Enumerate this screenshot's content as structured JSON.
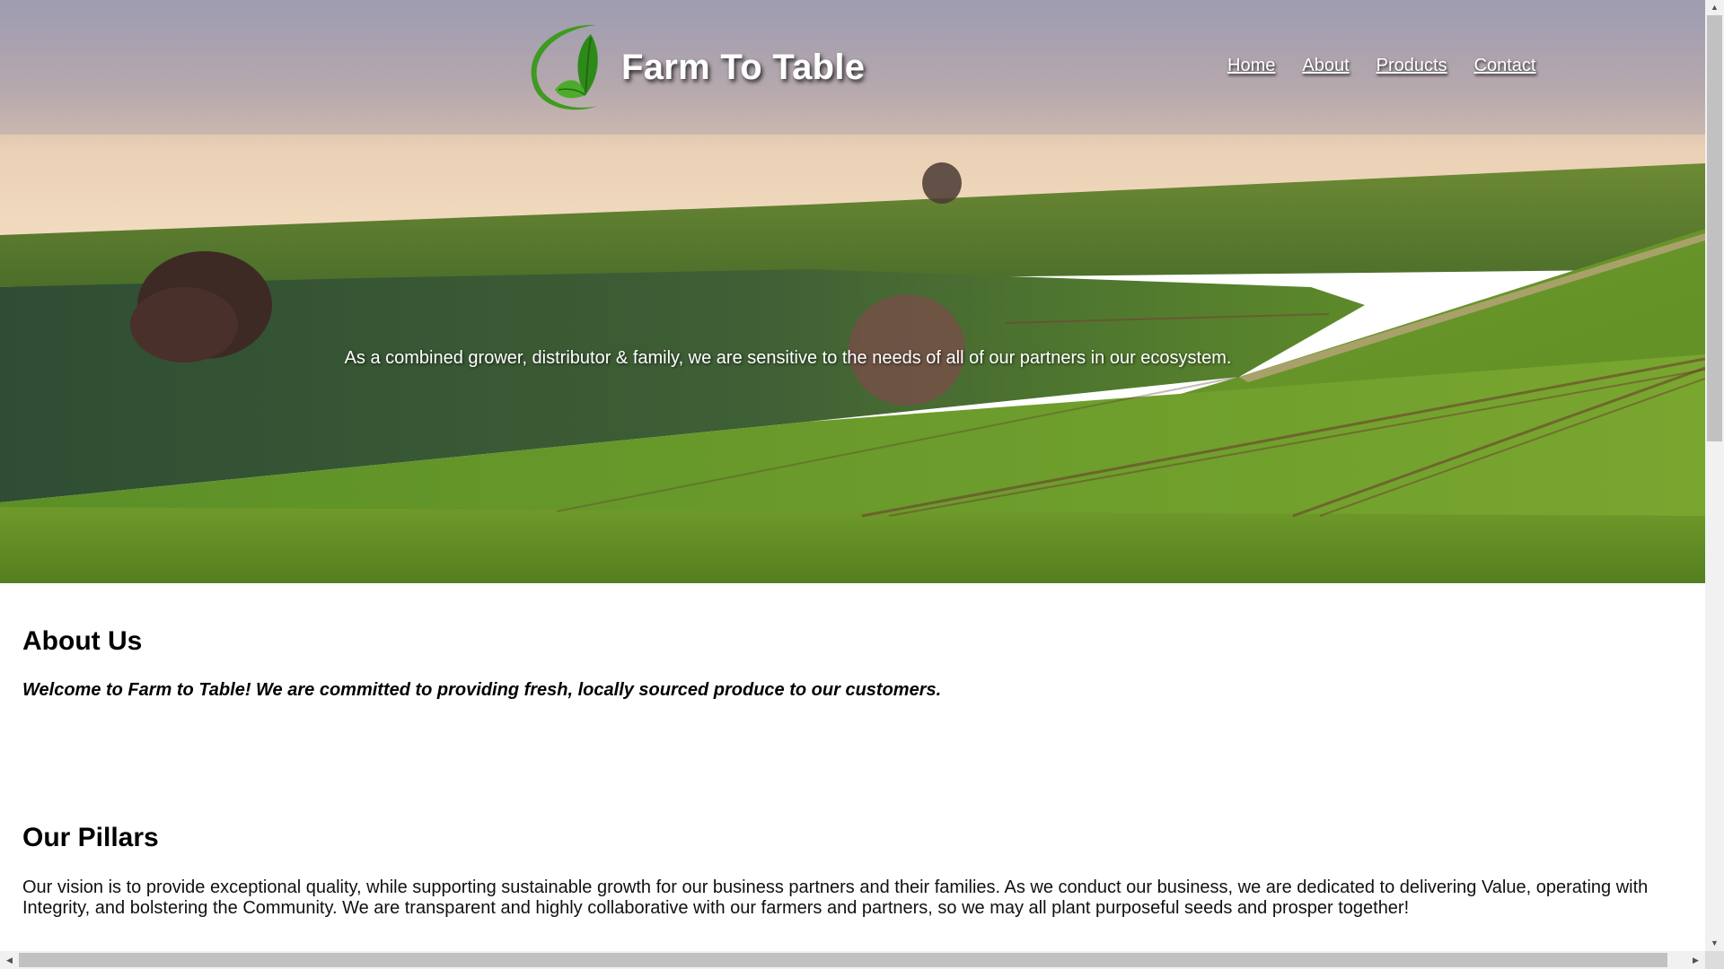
{
  "site": {
    "brand_name": "Farm To Table",
    "logo_icon": "leaf-swoosh-logo",
    "colors": {
      "logo_green": "#3f9a22",
      "logo_dark_green": "#1f6a12",
      "nav_text": "#ffffff",
      "body_text": "#000000"
    }
  },
  "nav": {
    "items": [
      {
        "label": "Home"
      },
      {
        "label": "About"
      },
      {
        "label": "Products"
      },
      {
        "label": "Contact"
      }
    ]
  },
  "hero": {
    "tagline": "As a combined grower, distributor & family, we are sensitive to the needs of all of our partners in our ecosystem.",
    "background_icon": "green-rolling-hills-image"
  },
  "about": {
    "title": "About Us",
    "text": "Welcome to Farm to Table! We are committed to providing fresh, locally sourced produce to our customers."
  },
  "pillars": {
    "title": "Our Pillars",
    "text": "Our vision is to provide exceptional quality, while supporting sustainable growth for our business partners and their families. As we conduct our business, we are dedicated to delivering Value, operating with Integrity, and bolstering the Community. We are transparent and highly collaborative with our farmers and partners, so we may all plant purposeful seeds and prosper together!"
  },
  "scrollbars": {
    "vertical_up_icon": "triangle-up-icon",
    "vertical_down_icon": "triangle-down-icon",
    "horizontal_left_icon": "triangle-left-icon",
    "horizontal_right_icon": "triangle-right-icon"
  }
}
